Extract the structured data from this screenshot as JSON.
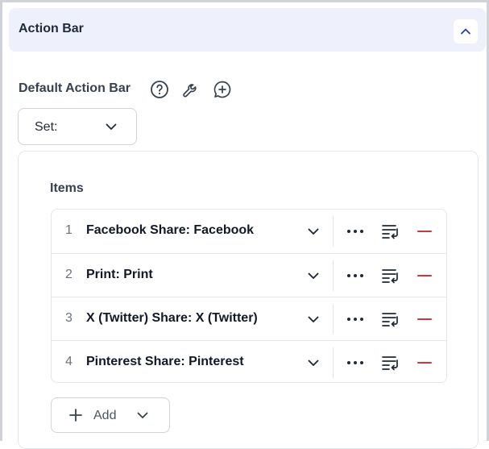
{
  "panel": {
    "title": "Action Bar"
  },
  "section": {
    "label": "Default Action Bar",
    "icons": [
      "help-circle-icon",
      "wrench-icon",
      "add-comment-icon"
    ]
  },
  "set_select": {
    "label": "Set:"
  },
  "items": {
    "label": "Items",
    "rows": [
      {
        "index": "1",
        "label": "Facebook Share: Facebook"
      },
      {
        "index": "2",
        "label": "Print: Print"
      },
      {
        "index": "3",
        "label": "X (Twitter) Share: X (Twitter)"
      },
      {
        "index": "4",
        "label": "Pinterest Share: Pinterest"
      }
    ],
    "add_label": "Add"
  },
  "colors": {
    "header_bg": "#eef1fb",
    "remove_red": "#d1343a",
    "accent_blue": "#1e40af"
  }
}
